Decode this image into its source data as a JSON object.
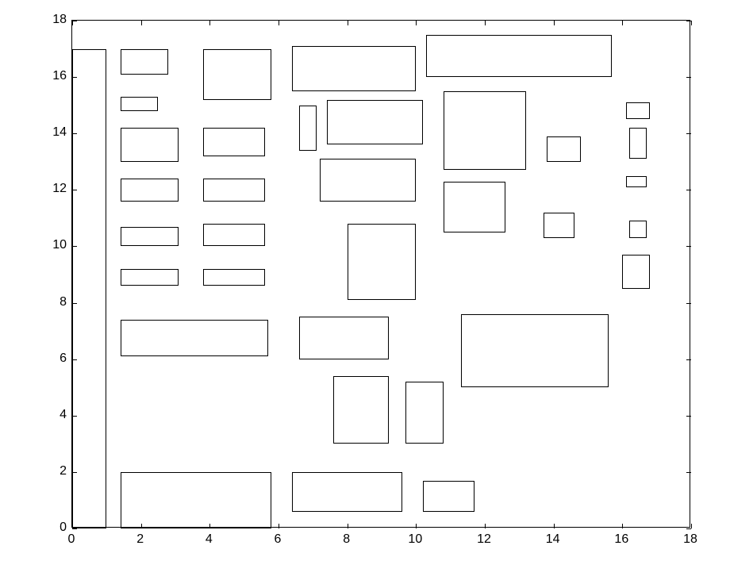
{
  "chart_data": {
    "type": "scatter",
    "xlim": [
      0,
      18
    ],
    "ylim": [
      0,
      18
    ],
    "xticks": [
      0,
      2,
      4,
      6,
      8,
      10,
      12,
      14,
      16,
      18
    ],
    "yticks": [
      0,
      2,
      4,
      6,
      8,
      10,
      12,
      14,
      16,
      18
    ],
    "title": "",
    "xlabel": "",
    "ylabel": "",
    "rectangles": [
      {
        "x": 0.0,
        "y": 0.0,
        "w": 1.0,
        "h": 17.0
      },
      {
        "x": 1.4,
        "y": 0.0,
        "w": 4.4,
        "h": 2.0
      },
      {
        "x": 6.4,
        "y": 0.6,
        "w": 3.2,
        "h": 1.4
      },
      {
        "x": 10.2,
        "y": 0.6,
        "w": 1.5,
        "h": 1.1
      },
      {
        "x": 7.6,
        "y": 3.0,
        "w": 1.6,
        "h": 2.4
      },
      {
        "x": 9.7,
        "y": 3.0,
        "w": 1.1,
        "h": 2.2
      },
      {
        "x": 11.3,
        "y": 5.0,
        "w": 4.3,
        "h": 2.6
      },
      {
        "x": 6.6,
        "y": 6.0,
        "w": 2.6,
        "h": 1.5
      },
      {
        "x": 1.4,
        "y": 6.1,
        "w": 4.3,
        "h": 1.3
      },
      {
        "x": 8.0,
        "y": 8.1,
        "w": 2.0,
        "h": 2.7
      },
      {
        "x": 1.4,
        "y": 8.6,
        "w": 1.7,
        "h": 0.6
      },
      {
        "x": 3.8,
        "y": 8.6,
        "w": 1.8,
        "h": 0.6
      },
      {
        "x": 16.0,
        "y": 8.5,
        "w": 0.8,
        "h": 1.2
      },
      {
        "x": 1.4,
        "y": 10.0,
        "w": 1.7,
        "h": 0.7
      },
      {
        "x": 3.8,
        "y": 10.0,
        "w": 1.8,
        "h": 0.8
      },
      {
        "x": 13.7,
        "y": 10.3,
        "w": 0.9,
        "h": 0.9
      },
      {
        "x": 16.2,
        "y": 10.3,
        "w": 0.5,
        "h": 0.6
      },
      {
        "x": 10.8,
        "y": 10.5,
        "w": 1.8,
        "h": 1.8
      },
      {
        "x": 1.4,
        "y": 11.6,
        "w": 1.7,
        "h": 0.8
      },
      {
        "x": 3.8,
        "y": 11.6,
        "w": 1.8,
        "h": 0.8
      },
      {
        "x": 7.2,
        "y": 11.6,
        "w": 2.8,
        "h": 1.5
      },
      {
        "x": 16.1,
        "y": 12.1,
        "w": 0.6,
        "h": 0.4
      },
      {
        "x": 1.4,
        "y": 13.0,
        "w": 1.7,
        "h": 1.2
      },
      {
        "x": 3.8,
        "y": 13.2,
        "w": 1.8,
        "h": 1.0
      },
      {
        "x": 10.8,
        "y": 12.7,
        "w": 2.4,
        "h": 2.8
      },
      {
        "x": 13.8,
        "y": 13.0,
        "w": 1.0,
        "h": 0.9
      },
      {
        "x": 16.2,
        "y": 13.1,
        "w": 0.5,
        "h": 1.1
      },
      {
        "x": 6.6,
        "y": 13.4,
        "w": 0.5,
        "h": 1.6
      },
      {
        "x": 7.4,
        "y": 13.6,
        "w": 2.8,
        "h": 1.6
      },
      {
        "x": 1.4,
        "y": 14.8,
        "w": 1.1,
        "h": 0.5
      },
      {
        "x": 16.1,
        "y": 14.5,
        "w": 0.7,
        "h": 0.6
      },
      {
        "x": 3.8,
        "y": 15.2,
        "w": 2.0,
        "h": 1.8
      },
      {
        "x": 6.4,
        "y": 15.5,
        "w": 3.6,
        "h": 1.6
      },
      {
        "x": 10.3,
        "y": 16.0,
        "w": 5.4,
        "h": 1.5
      },
      {
        "x": 1.4,
        "y": 16.1,
        "w": 1.4,
        "h": 0.9
      }
    ]
  }
}
